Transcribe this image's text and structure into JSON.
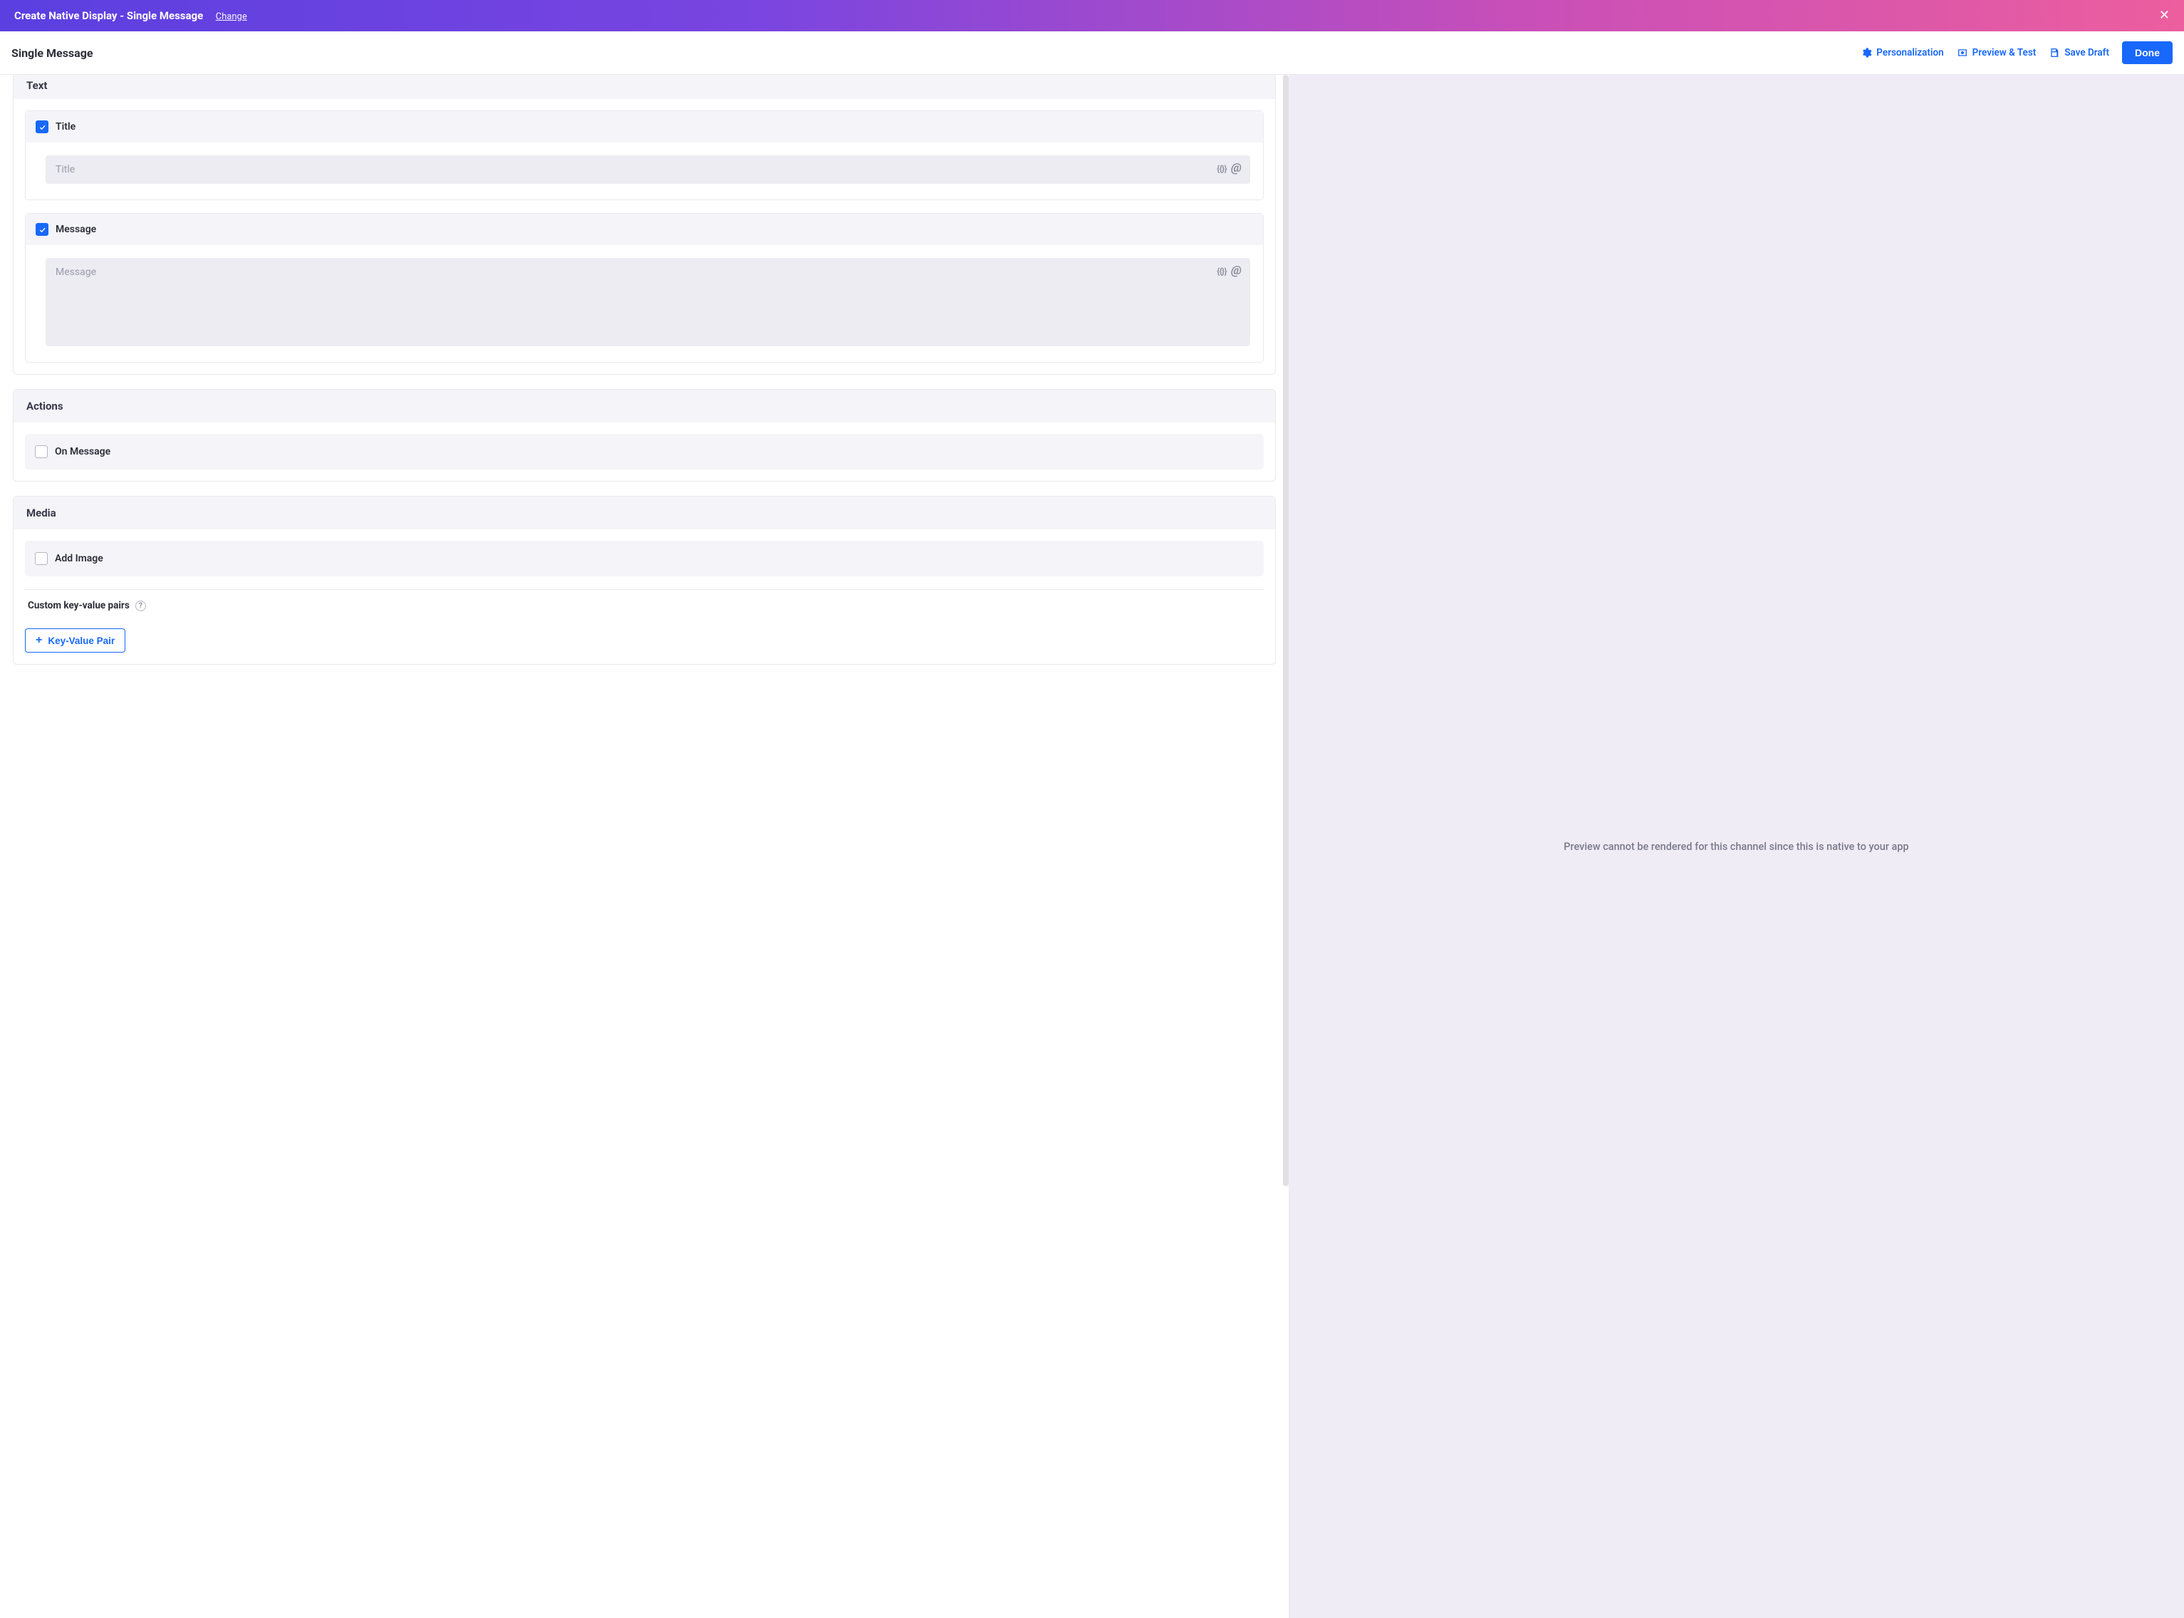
{
  "banner": {
    "title": "Create Native Display - Single Message",
    "change": "Change"
  },
  "toolbar": {
    "title": "Single Message",
    "personalization": "Personalization",
    "preview": "Preview & Test",
    "save_draft": "Save Draft",
    "done": "Done"
  },
  "sections": {
    "text": {
      "title": "Text"
    },
    "actions": {
      "title": "Actions"
    },
    "media": {
      "title": "Media"
    }
  },
  "fields": {
    "title": {
      "label": "Title",
      "placeholder": "Title"
    },
    "message": {
      "label": "Message",
      "placeholder": "Message"
    },
    "on_message": {
      "label": "On Message"
    },
    "add_image": {
      "label": "Add Image"
    }
  },
  "custom_kv": {
    "heading": "Custom key-value pairs",
    "button": "Key-Value Pair"
  },
  "icons": {
    "braces": "{{}}",
    "at": "@"
  },
  "preview": {
    "message": "Preview cannot be rendered for this channel since this is native to your app"
  }
}
